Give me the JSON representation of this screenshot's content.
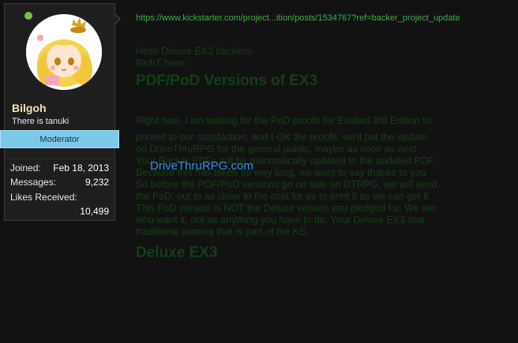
{
  "user": {
    "name": "Bilgoh",
    "title": "There is tanuki",
    "role": "Moderator",
    "stats": [
      {
        "label": "Joined:",
        "value": "Feb 18, 2013"
      },
      {
        "label": "Messages:",
        "value": "9,232"
      },
      {
        "label": "Likes Received:",
        "value": "10,499"
      }
    ]
  },
  "colors": {
    "online": "#7ac143",
    "moderator_bg": "#7cc9ea",
    "link": "#3fae49",
    "overlay_link": "#2f8fe6"
  },
  "post": {
    "link": "https://www.kickstarter.com/project...ition/posts/1534767?ref=backer_project_update",
    "greeting": "Hello Deluxe EX3 backers-",
    "signoff": "RichT here:",
    "heading": "PDF/PoD Versions of EX3",
    "lines": [
      "Right now, I am waiting for the PoD proofs for Exalted 3rd Edition to",
      "printed to our satisfaction, and I OK the proofs, we'll put the update",
      "on DriveThruRPG for the general public, maybe as soon as next",
      "Your Backer PDFs will be automatically updated to the updated PDF",
      "Because this has taken so very long, we want to say thanks to you",
      "So before the PDF/PoD versions go on sale on DTRPG, we will send",
      "the PoD, out to as close to the cost for us to print it as we can get it",
      "This PoD version is NOT the Deluxe version you pledged for. We are",
      "who want it, not as anything you have to do. Your Deluxe EX3 that",
      "traditional printing that is part of the KS."
    ],
    "heading2": "Deluxe EX3",
    "overlay_link": "DriveThruRPG.com"
  }
}
